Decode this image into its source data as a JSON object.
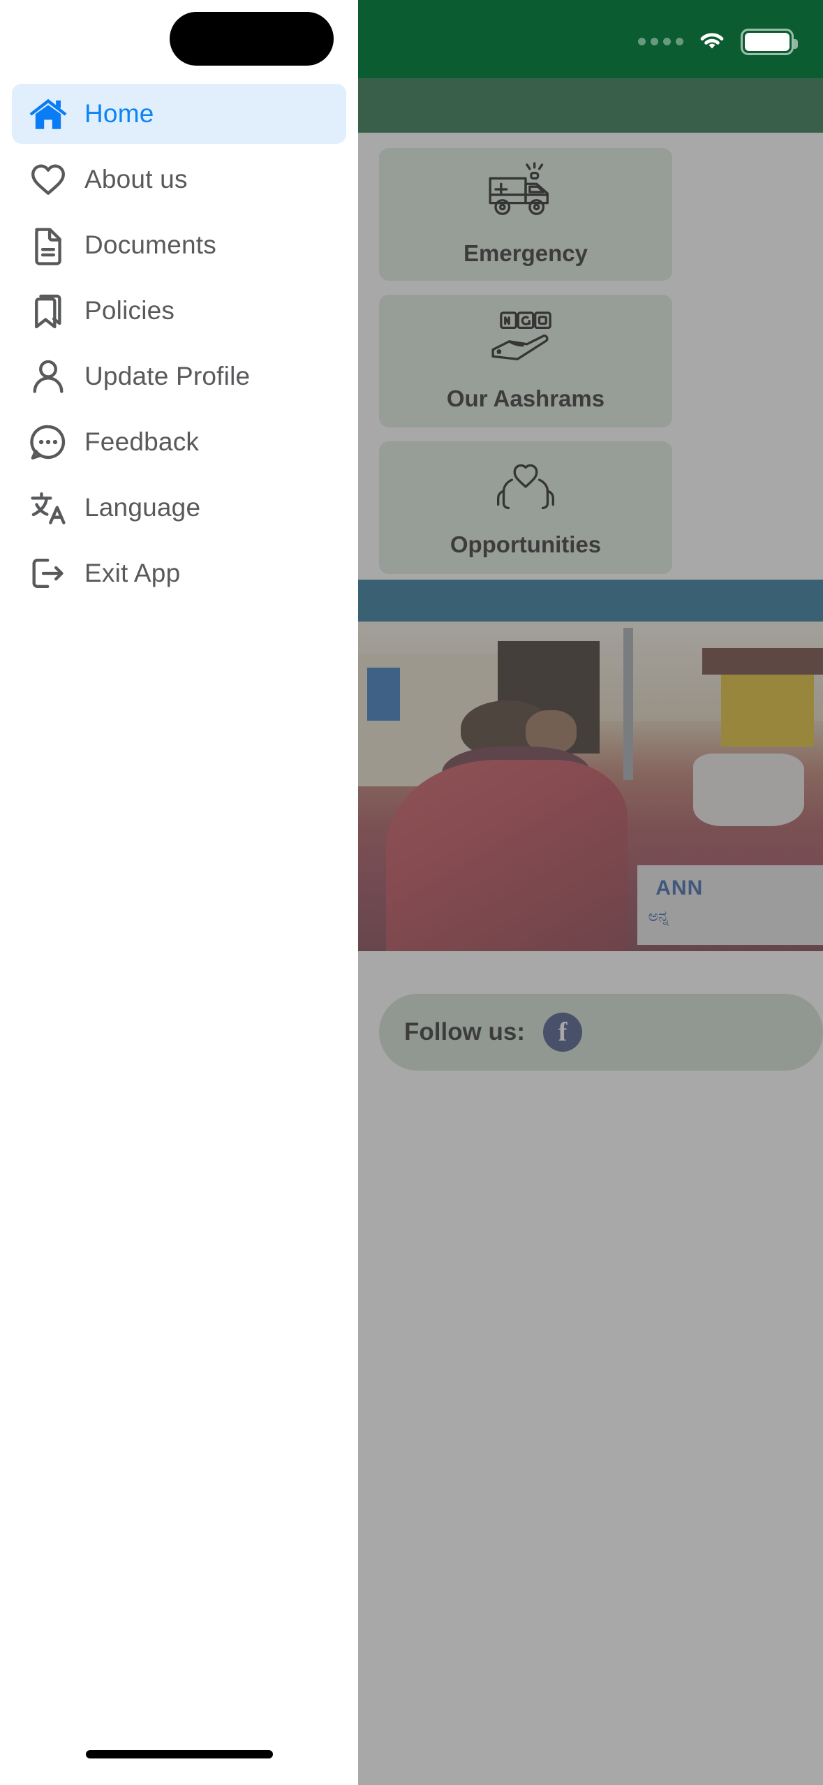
{
  "status_bar": {
    "signal_icon": "signal-dots-icon",
    "wifi_icon": "wifi-icon",
    "battery_icon": "battery-icon",
    "background_color": "#0b5c30"
  },
  "app_bar": {
    "menu_icon": "hamburger-menu-icon",
    "background_color": "#0b5c30"
  },
  "drawer": {
    "background_color": "#ffffff",
    "active_background_color": "#e1effd",
    "active_text_color": "#0a84f7",
    "text_color": "#58595b",
    "items": [
      {
        "label": "Home",
        "icon": "home-icon",
        "active": true
      },
      {
        "label": "About us",
        "icon": "heart-icon",
        "active": false
      },
      {
        "label": "Documents",
        "icon": "document-icon",
        "active": false
      },
      {
        "label": "Policies",
        "icon": "bookmarks-icon",
        "active": false
      },
      {
        "label": "Update Profile",
        "icon": "user-icon",
        "active": false
      },
      {
        "label": "Feedback",
        "icon": "chat-bubble-icon",
        "active": false
      },
      {
        "label": "Language",
        "icon": "translate-icon",
        "active": false
      },
      {
        "label": "Exit App",
        "icon": "logout-icon",
        "active": false
      }
    ]
  },
  "home_page": {
    "tiles": [
      {
        "label": "Emergency",
        "icon": "ambulance-icon"
      },
      {
        "label": "Our Aashrams",
        "icon": "ngo-hand-icon"
      },
      {
        "label": "Opportunities",
        "icon": "hands-heart-icon"
      }
    ],
    "tile_background_color": "#d9e6da",
    "banner_color": "#0a6189",
    "photo_caption_primary": "ANN",
    "photo_caption_secondary": "ಅನ್ನ",
    "follow": {
      "label": "Follow us:",
      "facebook_glyph": "f",
      "facebook_color": "#2c3e73",
      "bar_color": "#cddccf"
    }
  }
}
